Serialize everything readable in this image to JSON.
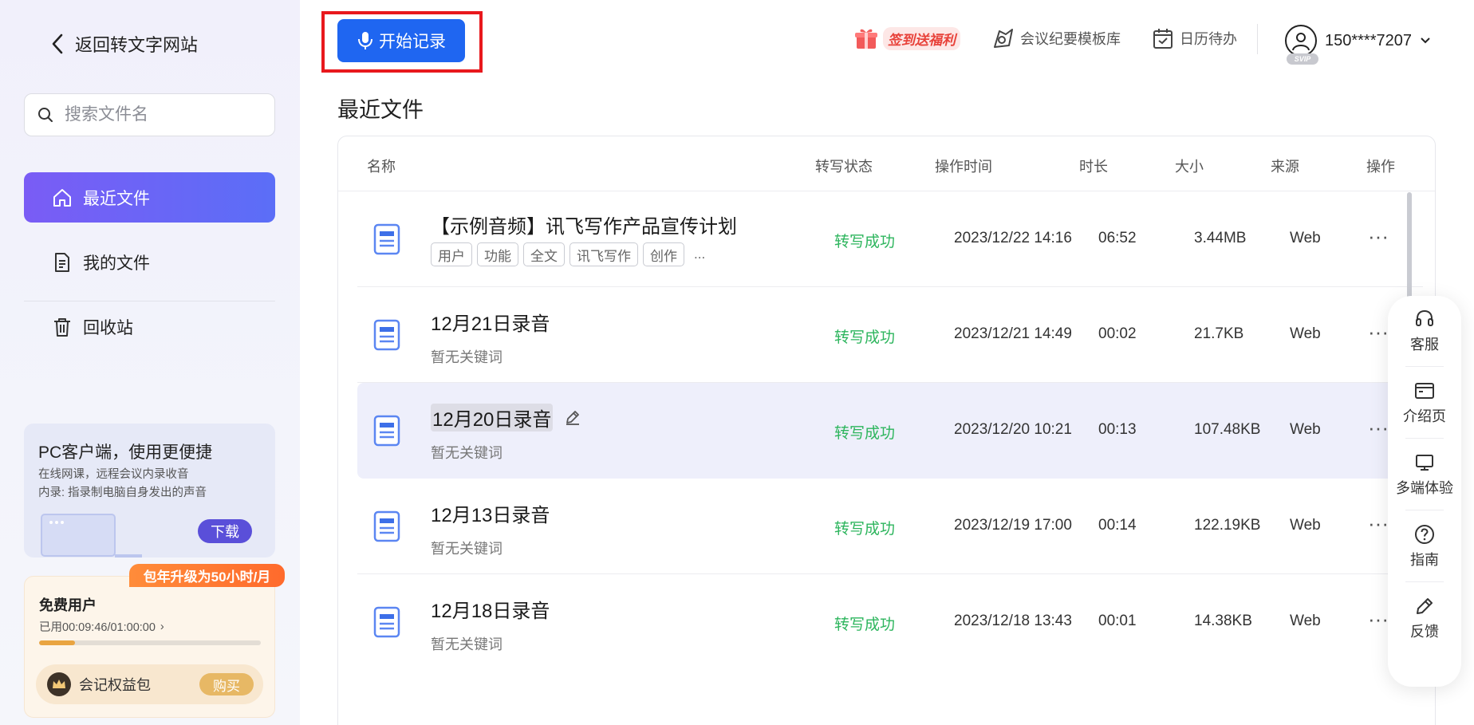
{
  "sidebar": {
    "back_label": "返回转文字网站",
    "search_placeholder": "搜索文件名",
    "nav": [
      {
        "label": "最近文件",
        "icon": "home-icon",
        "active": true
      },
      {
        "label": "我的文件",
        "icon": "file-icon",
        "active": false
      },
      {
        "label": "回收站",
        "icon": "trash-icon",
        "active": false
      }
    ],
    "pc_card": {
      "title": "PC客户端，使用更便捷",
      "line1": "在线网课，远程会议内录收音",
      "line2": "内录: 指录制电脑自身发出的声音",
      "download_label": "下载"
    },
    "upgrade_tag": "包年升级为50小时/月",
    "user_card": {
      "type": "免费用户",
      "usage": "已用00:09:46/01:00:00",
      "usage_fraction": 0.163,
      "benefit_label": "会记权益包",
      "buy_label": "购买"
    }
  },
  "header": {
    "start_label": "开始记录",
    "gift_label": "签到送福利",
    "template_label": "会议纪要模板库",
    "calendar_label": "日历待办",
    "user_label": "150****7207",
    "svip_badge": "SVIP"
  },
  "main": {
    "section_title": "最近文件",
    "columns": {
      "name": "名称",
      "status": "转写状态",
      "time": "操作时间",
      "duration": "时长",
      "size": "大小",
      "source": "来源",
      "actions": "操作"
    },
    "rows": [
      {
        "name": "【示例音频】讯飞写作产品宣传计划",
        "tags": [
          "用户",
          "功能",
          "全文",
          "讯飞写作",
          "创作"
        ],
        "tags_more": "...",
        "keywords": "",
        "status": "转写成功",
        "time": "2023/12/22 14:16",
        "duration": "06:52",
        "size": "3.44MB",
        "source": "Web",
        "more": "···"
      },
      {
        "name": "12月21日录音",
        "keywords": "暂无关键词",
        "status": "转写成功",
        "time": "2023/12/21 14:49",
        "duration": "00:02",
        "size": "21.7KB",
        "source": "Web",
        "more": "···"
      },
      {
        "name": "12月20日录音",
        "keywords": "暂无关键词",
        "status": "转写成功",
        "time": "2023/12/20 10:21",
        "duration": "00:13",
        "size": "107.48KB",
        "source": "Web",
        "more": "···"
      },
      {
        "name": "12月13日录音",
        "keywords": "暂无关键词",
        "status": "转写成功",
        "time": "2023/12/19 17:00",
        "duration": "00:14",
        "size": "122.19KB",
        "source": "Web",
        "more": "···"
      },
      {
        "name": "12月18日录音",
        "keywords": "暂无关键词",
        "status": "转写成功",
        "time": "2023/12/18 13:43",
        "duration": "00:01",
        "size": "14.38KB",
        "source": "Web",
        "more": "···"
      }
    ]
  },
  "float_bar": {
    "items": [
      {
        "label": "客服",
        "icon": "headset-icon"
      },
      {
        "label": "介绍页",
        "icon": "browser-icon"
      },
      {
        "label": "多端体验",
        "icon": "monitor-icon"
      },
      {
        "label": "指南",
        "icon": "help-icon"
      },
      {
        "label": "反馈",
        "icon": "pen-icon"
      }
    ]
  },
  "colors": {
    "accent_blue": "#1f66f1",
    "nav_active_start": "#7a5cf5",
    "nav_active_end": "#5b6ef7",
    "status_success": "#2db55d",
    "highlight_red": "#e8181d",
    "upgrade_orange": "#ff7a30"
  }
}
